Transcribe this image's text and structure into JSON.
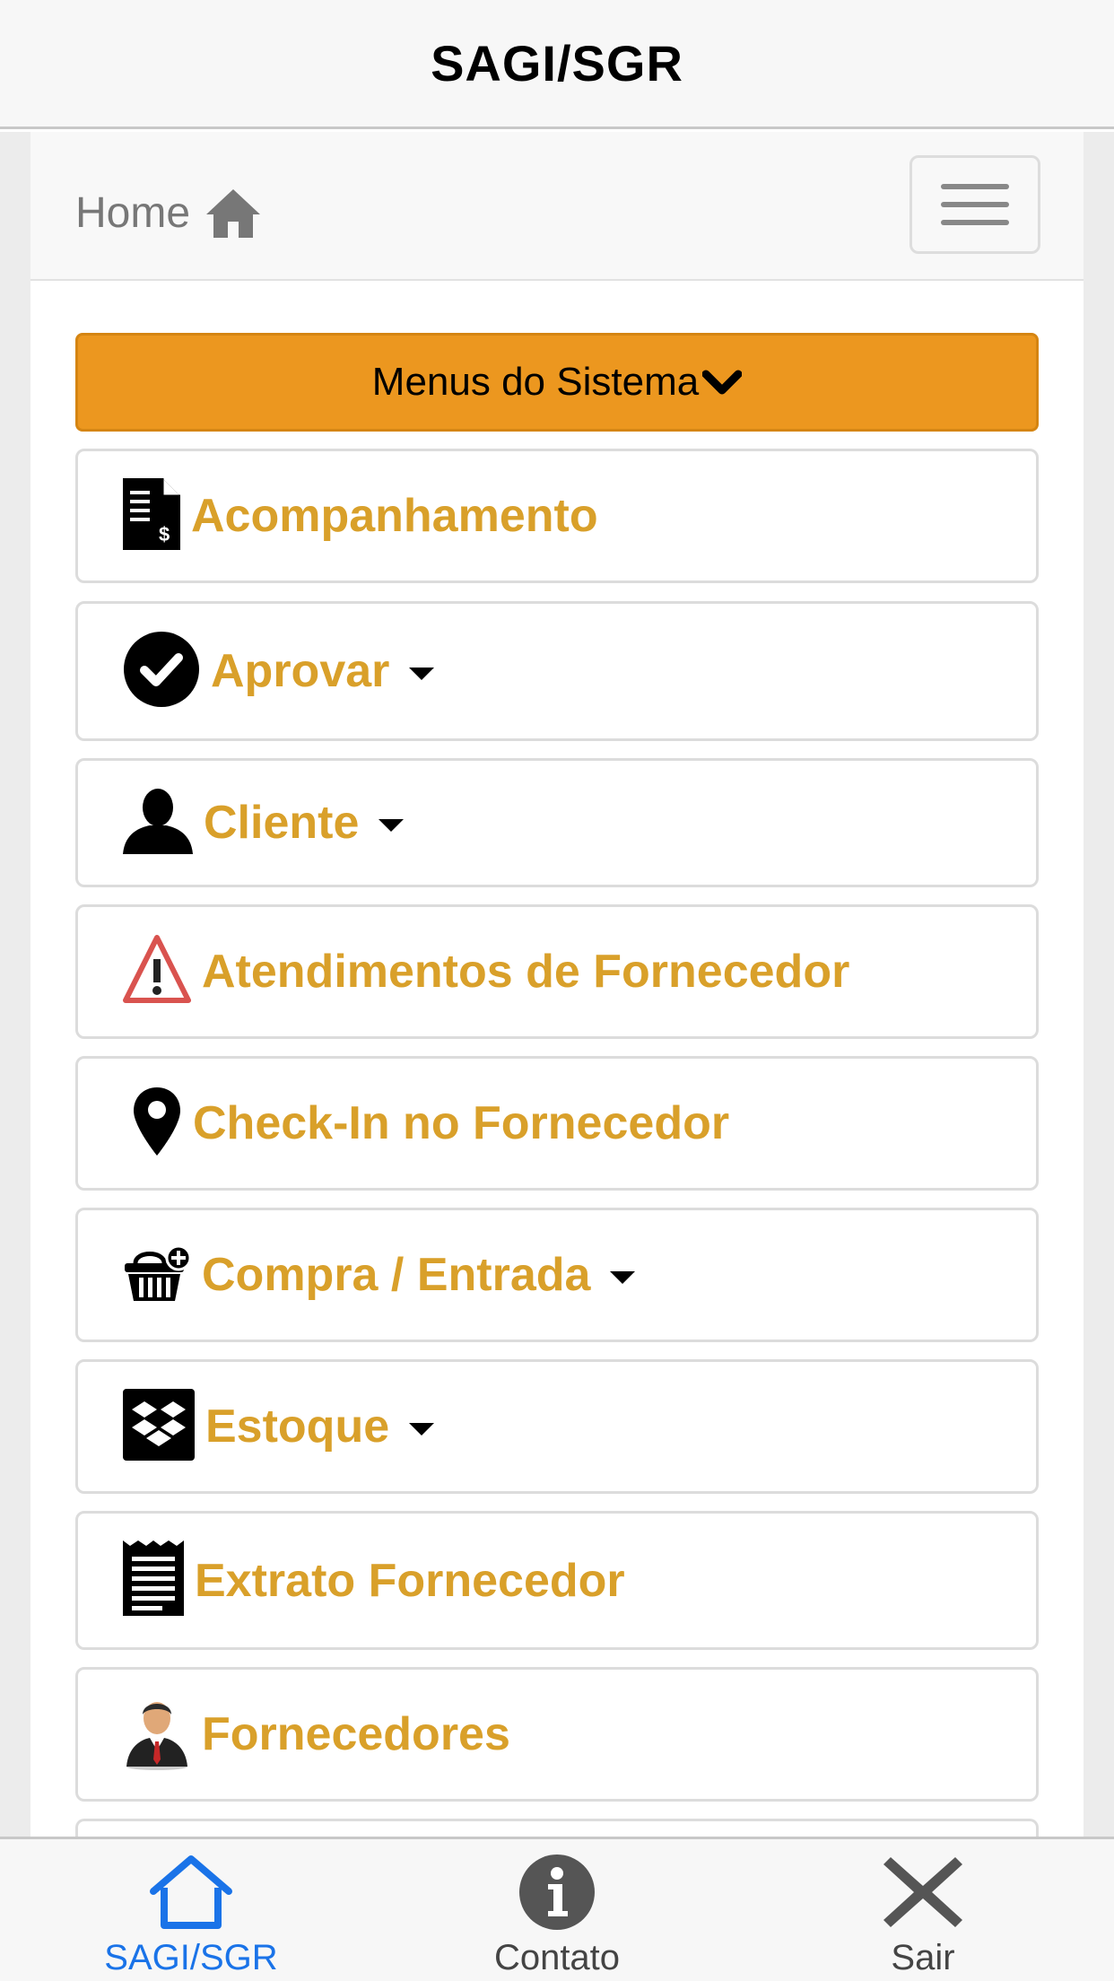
{
  "header": {
    "title": "SAGI/SGR"
  },
  "breadcrumb": {
    "home_label": "Home"
  },
  "menus_button": {
    "label": "Menus do Sistema"
  },
  "menu_items": [
    {
      "label": "Acompanhamento",
      "icon": "invoice-icon",
      "has_dropdown": false
    },
    {
      "label": "Aprovar",
      "icon": "checkmark-circle-icon",
      "has_dropdown": true
    },
    {
      "label": "Cliente",
      "icon": "person-icon",
      "has_dropdown": true
    },
    {
      "label": "Atendimentos de Fornecedor",
      "icon": "warning-icon",
      "has_dropdown": false
    },
    {
      "label": "Check-In no Fornecedor",
      "icon": "map-pin-icon",
      "has_dropdown": false
    },
    {
      "label": "Compra / Entrada",
      "icon": "basket-add-icon",
      "has_dropdown": true
    },
    {
      "label": "Estoque",
      "icon": "dropbox-icon",
      "has_dropdown": true
    },
    {
      "label": "Extrato Fornecedor",
      "icon": "receipt-icon",
      "has_dropdown": false
    },
    {
      "label": "Fornecedores",
      "icon": "businessman-icon",
      "has_dropdown": false
    }
  ],
  "tabbar": {
    "tabs": [
      {
        "label": "SAGI/SGR",
        "icon": "home-outline-icon",
        "active": true
      },
      {
        "label": "Contato",
        "icon": "info-icon",
        "active": false
      },
      {
        "label": "Sair",
        "icon": "close-icon",
        "active": false
      }
    ]
  },
  "colors": {
    "accent_button": "#ec971f",
    "menu_text": "#d9a02a",
    "active_tab": "#1a73e8"
  }
}
